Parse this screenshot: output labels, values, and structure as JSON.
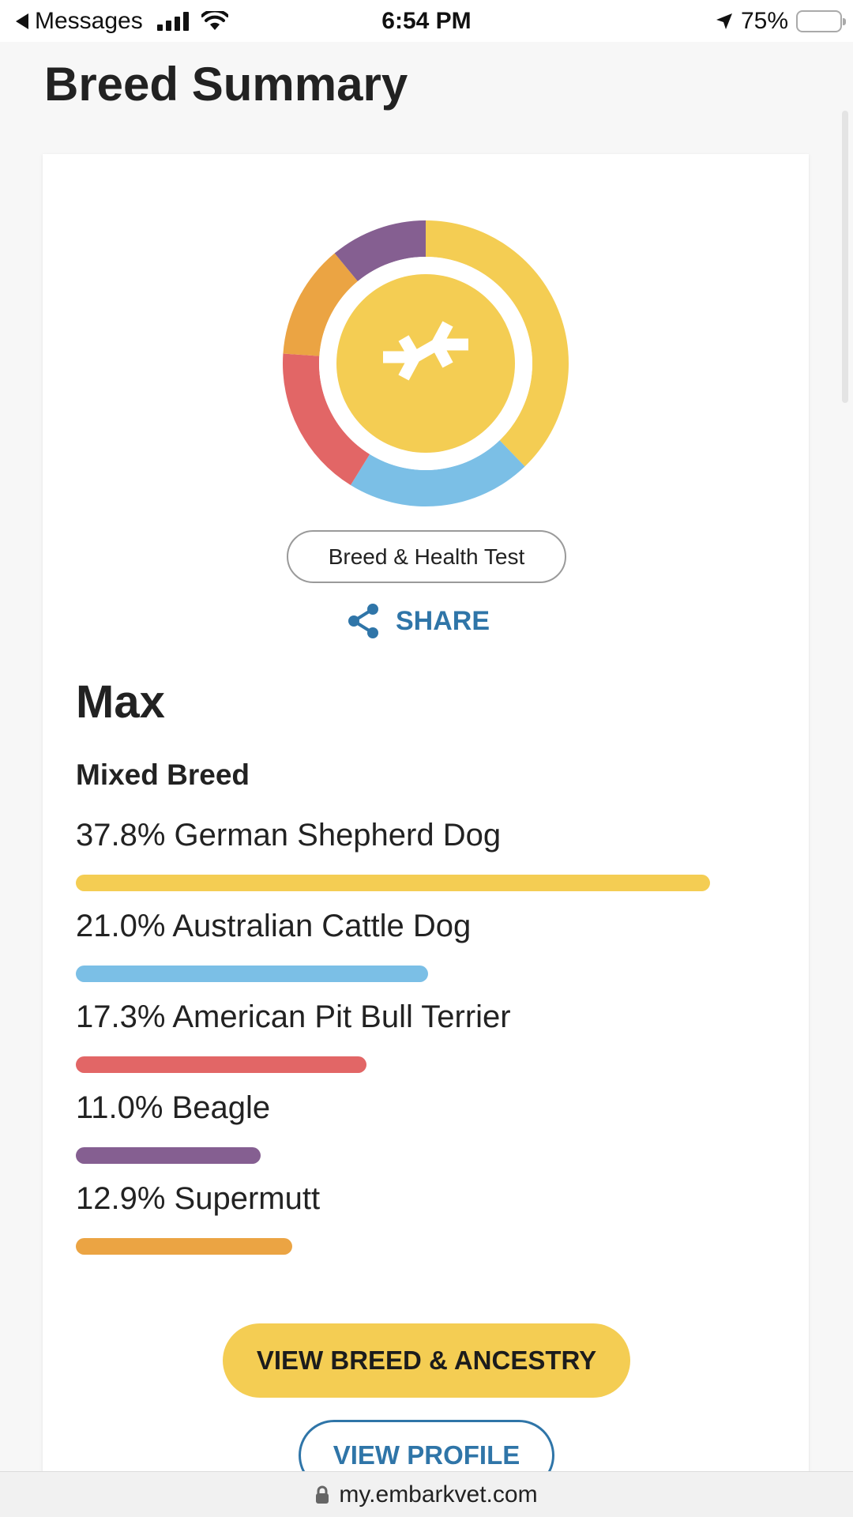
{
  "status_bar": {
    "back_app": "Messages",
    "time": "6:54 PM",
    "battery": "75%",
    "battery_level": 0.75
  },
  "page": {
    "title": "Breed Summary"
  },
  "test_badge": "Breed & Health Test",
  "share_label": "SHARE",
  "dog": {
    "name": "Max",
    "breed_type": "Mixed Breed"
  },
  "breeds": [
    {
      "percent": 37.8,
      "label": "37.8% German Shepherd Dog",
      "color": "#f4cd53"
    },
    {
      "percent": 21.0,
      "label": "21.0% Australian Cattle Dog",
      "color": "#7bbfe6"
    },
    {
      "percent": 17.3,
      "label": "17.3% American Pit Bull Terrier",
      "color": "#e26666"
    },
    {
      "percent": 11.0,
      "label": "11.0% Beagle",
      "color": "#855f91"
    },
    {
      "percent": 12.9,
      "label": "12.9% Supermutt",
      "color": "#eba443"
    }
  ],
  "buttons": {
    "view_breed": "VIEW BREED & ANCESTRY",
    "view_profile": "VIEW PROFILE"
  },
  "address_bar": {
    "url": "my.embarkvet.com"
  },
  "colors": {
    "accent_yellow": "#f4cd53",
    "link_blue": "#2f75a8"
  }
}
